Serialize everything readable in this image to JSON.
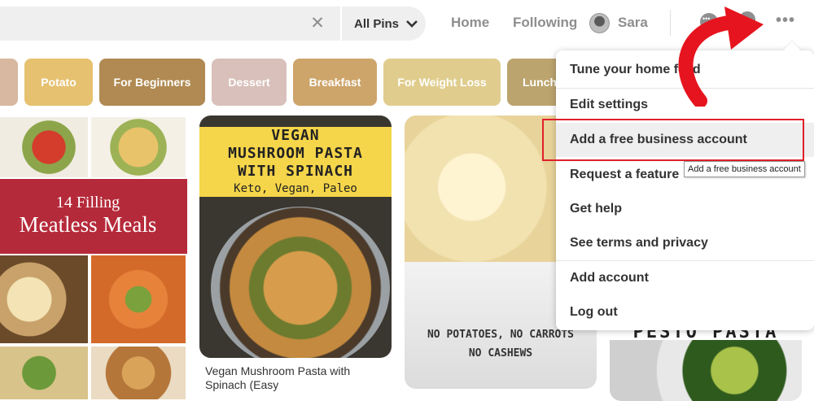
{
  "header": {
    "search": {
      "value": "",
      "placeholder": ""
    },
    "scope_label": "All Pins",
    "nav": {
      "home": "Home",
      "following": "Following"
    },
    "profile_name": "Sara",
    "icons": [
      "close-icon",
      "chevron-down-icon",
      "message-icon",
      "notifications-icon",
      "more-icon"
    ]
  },
  "categories": [
    {
      "label": "",
      "color": "#d8b8a0"
    },
    {
      "label": "Potato",
      "color": "#e6c170"
    },
    {
      "label": "For Beginners",
      "color": "#b08a52"
    },
    {
      "label": "Dessert",
      "color": "#d9c0ba"
    },
    {
      "label": "Breakfast",
      "color": "#cda46a"
    },
    {
      "label": "For Weight Loss",
      "color": "#e0cd8e"
    },
    {
      "label": "Lunch",
      "color": "#bca46e"
    }
  ],
  "pins": {
    "collage": {
      "line1": "14 Filling",
      "line2": "Meatless Meals"
    },
    "pasta": {
      "banner_title_1": "VEGAN",
      "banner_title_2": "MUSHROOM PASTA",
      "banner_title_3": "WITH SPINACH",
      "banner_subtitle": "Keto, Vegan, Paleo",
      "caption": "Vegan Mushroom Pasta with Spinach (Easy"
    },
    "mac": {
      "line1": "NO POTATOES, NO CARROTS",
      "line2": "NO CASHEWS"
    },
    "pesto": {
      "title": "PESTO PASTA"
    }
  },
  "menu": {
    "items": [
      "Tune your home feed",
      "Edit settings",
      "Add a free business account",
      "Request a feature",
      "Get help",
      "See terms and privacy",
      "Add account",
      "Log out"
    ],
    "highlighted_index": 2,
    "tooltip": "Add a free business account"
  },
  "annotation": {
    "highlight_color": "#e0202a"
  }
}
